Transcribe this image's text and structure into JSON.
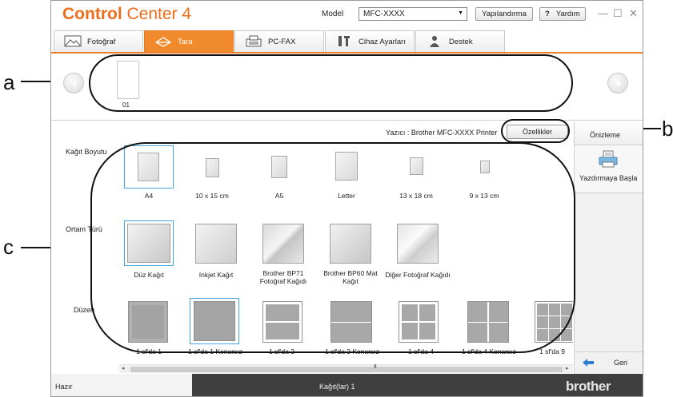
{
  "callouts": {
    "a": "a",
    "b": "b",
    "c": "c"
  },
  "app": {
    "logo_bold": "Control",
    "logo_rest": " Center 4",
    "accent": "#ec6d1a",
    "model_label": "Model",
    "model_value": "MFC-XXXX",
    "configure_label": "Yapılandırma",
    "help_q": "?",
    "help_label": "Yardım",
    "minimize": "—",
    "maximize": "☐",
    "close": "✕"
  },
  "tabs": [
    {
      "label": "Fotoğraf",
      "icon": "photo-icon"
    },
    {
      "label": "Tara",
      "icon": "scan-icon",
      "active": true
    },
    {
      "label": "PC-FAX",
      "icon": "fax-icon"
    },
    {
      "label": "Cihaz Ayarları",
      "icon": "tools-icon"
    },
    {
      "label": "Destek",
      "icon": "support-icon"
    }
  ],
  "preview": {
    "thumb_label": "01",
    "prev_icon": "chevron-left-icon",
    "next_icon": "chevron-right-icon"
  },
  "printer": {
    "text": "Yazıcı : Brother MFC-XXXX   Printer",
    "properties_label": "Özellikler"
  },
  "paper_size": {
    "label": "Kağıt Boyutu",
    "items": [
      "A4",
      "10 x 15 cm",
      "A5",
      "Letter",
      "13 x 18 cm",
      "9 x 13 cm"
    ]
  },
  "media_type": {
    "label": "Ortam Türü",
    "items": [
      "Düz Kağıt",
      "Inkjet Kağıt",
      "Brother BP71\nFotoğraf Kağıdı",
      "Brother BP60 Mat\nKağıt",
      "Diğer Fotoğraf Kağıdı"
    ]
  },
  "layout": {
    "label": "Düzen",
    "items": [
      "1 sf'da 1",
      "1 sf'da 1 Kenarsız",
      "1 sf'da 2",
      "1 sf'da 2 Kenarsız",
      "1 sf'da 4",
      "1 sf'da 4 Kenarsız",
      "1 sf'da 9"
    ]
  },
  "scrollbar": {
    "grip": "III",
    "left": "◂",
    "right": "▸"
  },
  "side": {
    "preview_label": "Önizleme",
    "print_label": "Yazdırmaya Başla",
    "back_label": "Geri"
  },
  "status": {
    "ready": "Hazır",
    "pages": "Kağıt(lar) 1",
    "brand": "brother"
  }
}
